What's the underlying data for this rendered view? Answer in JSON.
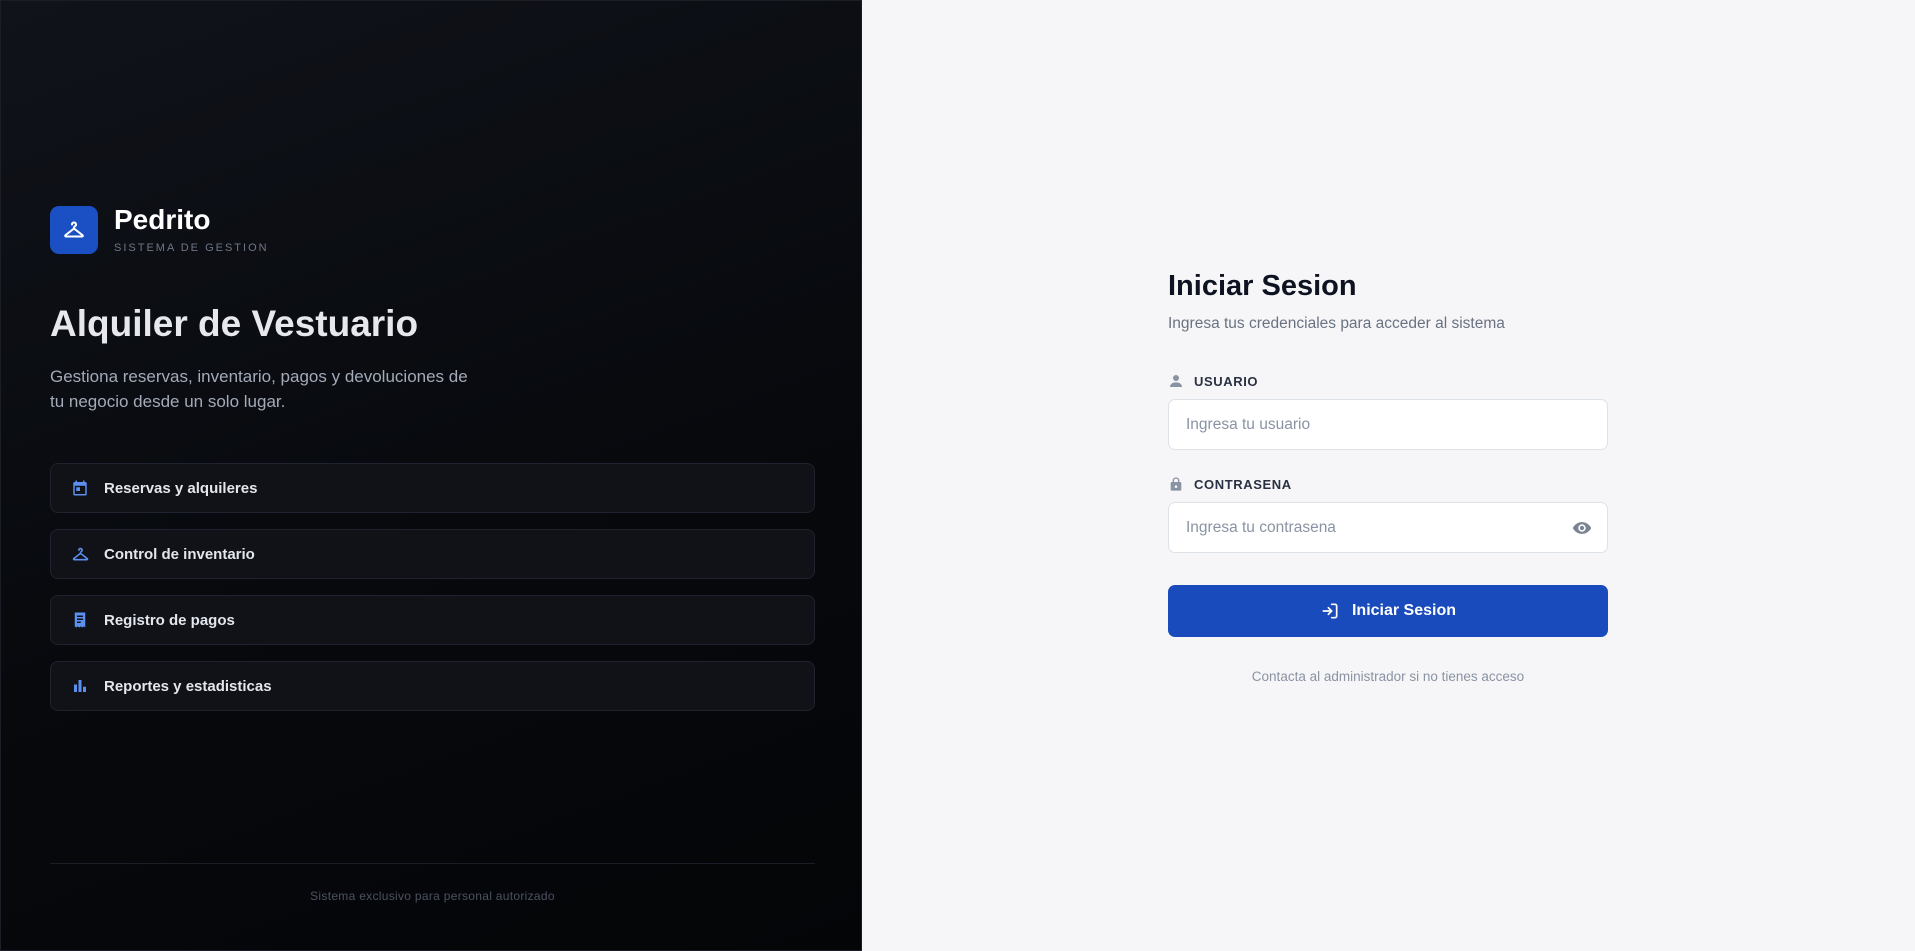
{
  "brand": {
    "name": "Pedrito",
    "subtitle": "SISTEMA DE GESTION",
    "logo_icon": "hanger-icon"
  },
  "hero": {
    "title": "Alquiler de Vestuario",
    "description": "Gestiona reservas, inventario, pagos y devoluciones de tu negocio desde un solo lugar."
  },
  "features": [
    {
      "label": "Reservas y alquileres",
      "icon": "calendar-icon"
    },
    {
      "label": "Control de inventario",
      "icon": "hanger-icon"
    },
    {
      "label": "Registro de pagos",
      "icon": "receipt-icon"
    },
    {
      "label": "Reportes y estadisticas",
      "icon": "bar-chart-icon"
    }
  ],
  "footer": {
    "text": "Sistema exclusivo para personal autorizado"
  },
  "login": {
    "title": "Iniciar Sesion",
    "subtitle": "Ingresa tus credenciales para acceder al sistema",
    "username": {
      "label": "USUARIO",
      "placeholder": "Ingresa tu usuario",
      "value": "",
      "icon": "user-icon"
    },
    "password": {
      "label": "CONTRASENA",
      "placeholder": "Ingresa tu contrasena",
      "value": "",
      "icon": "lock-icon",
      "toggle_icon": "eye-icon"
    },
    "submit_label": "Iniciar Sesion",
    "submit_icon": "login-icon",
    "help_text": "Contacta al administrador si no tienes acceso"
  },
  "colors": {
    "accent": "#1a4bbd",
    "feature_icon": "#5b8ff0",
    "left_bg": "#07090d",
    "right_bg": "#f6f6f8"
  }
}
